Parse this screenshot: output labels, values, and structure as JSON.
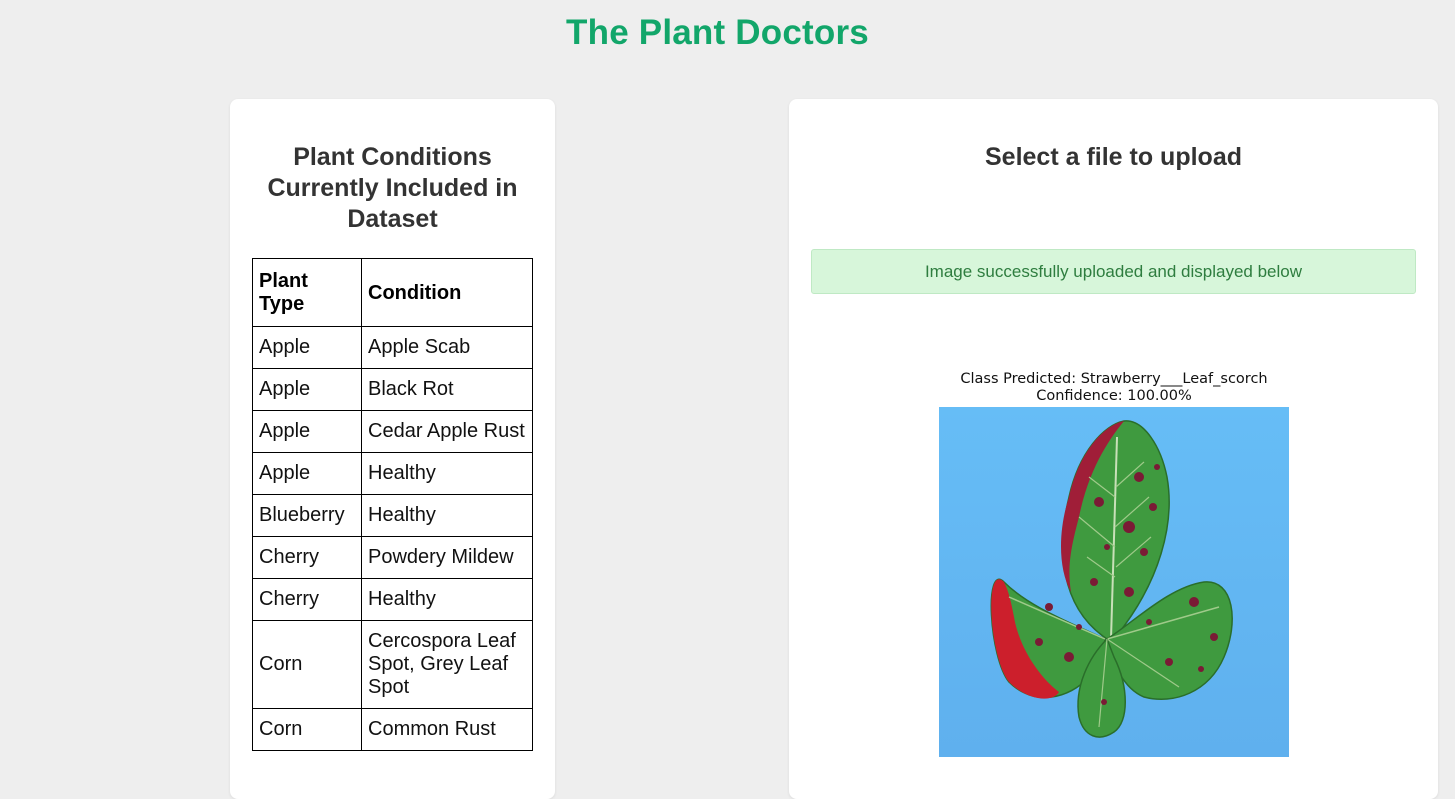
{
  "header": {
    "title": "The Plant Doctors"
  },
  "dataset_panel": {
    "heading": "Plant Conditions Currently Included in Dataset",
    "columns": [
      "Plant Type",
      "Condition"
    ],
    "rows": [
      {
        "type": "Apple",
        "condition": "Apple Scab"
      },
      {
        "type": "Apple",
        "condition": "Black Rot"
      },
      {
        "type": "Apple",
        "condition": "Cedar Apple Rust"
      },
      {
        "type": "Apple",
        "condition": "Healthy"
      },
      {
        "type": "Blueberry",
        "condition": "Healthy"
      },
      {
        "type": "Cherry",
        "condition": "Powdery Mildew"
      },
      {
        "type": "Cherry",
        "condition": "Healthy"
      },
      {
        "type": "Corn",
        "condition": "Cercospora Leaf Spot, Grey Leaf Spot"
      },
      {
        "type": "Corn",
        "condition": "Common Rust"
      }
    ]
  },
  "upload_panel": {
    "heading": "Select a file to upload",
    "success_message": "Image successfully uploaded and displayed below",
    "prediction": {
      "class_line": "Class Predicted: Strawberry___Leaf_scorch",
      "confidence_line": "Confidence: 100.00%"
    }
  },
  "colors": {
    "title": "#12a66a",
    "page_background": "#eeeeee",
    "alert_background": "#d7f6da",
    "alert_text": "#2e7d3f",
    "image_background": "#63b8f2"
  }
}
